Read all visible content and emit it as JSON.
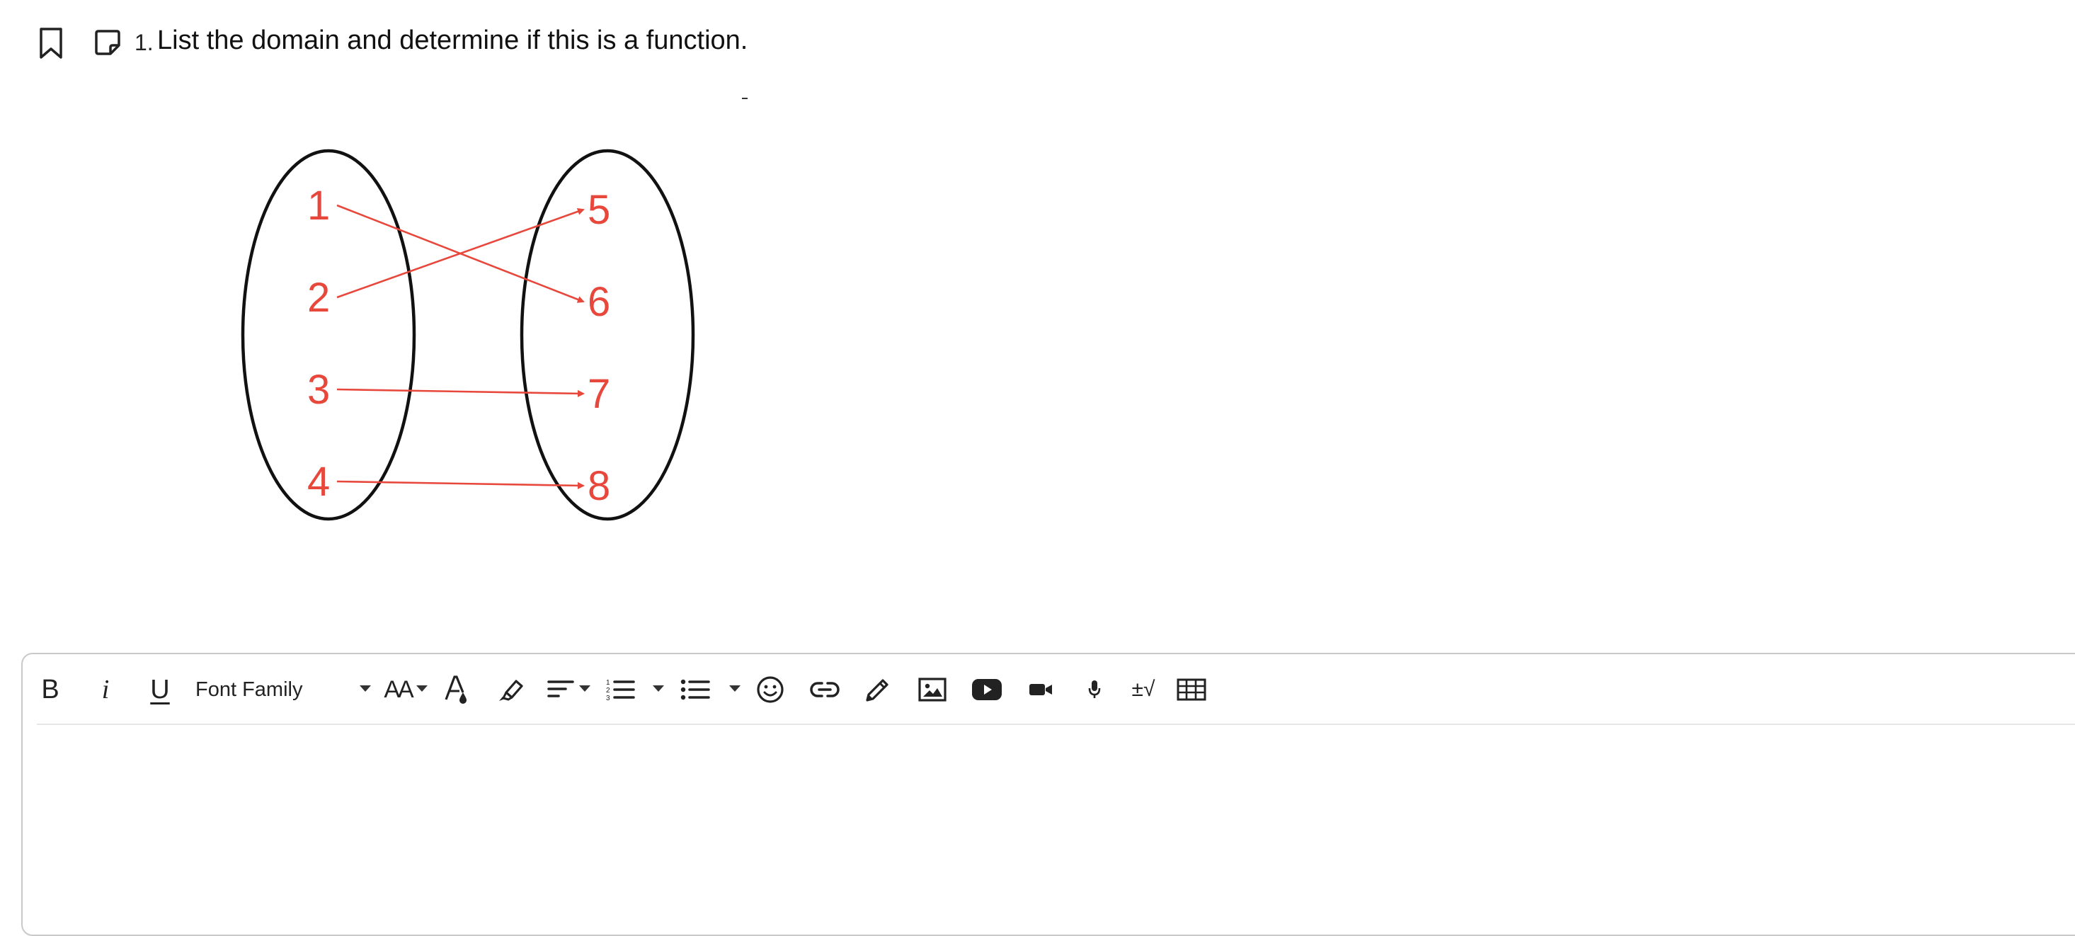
{
  "question": {
    "number": "1.",
    "text": "List the domain and determine if this is a function."
  },
  "diagram": {
    "domain": [
      "1",
      "2",
      "3",
      "4"
    ],
    "range": [
      "5",
      "6",
      "7",
      "8"
    ],
    "mappings": [
      [
        "1",
        "6"
      ],
      [
        "2",
        "5"
      ],
      [
        "3",
        "7"
      ],
      [
        "4",
        "8"
      ]
    ],
    "colors": {
      "oval": "#111111",
      "mapping": "#e8473b"
    }
  },
  "editor": {
    "toolbar": {
      "bold": "B",
      "italic": "i",
      "underline": "U",
      "font_family": "Font Family",
      "font_size_icon": "AA",
      "math_label": "±√"
    },
    "content": ""
  }
}
